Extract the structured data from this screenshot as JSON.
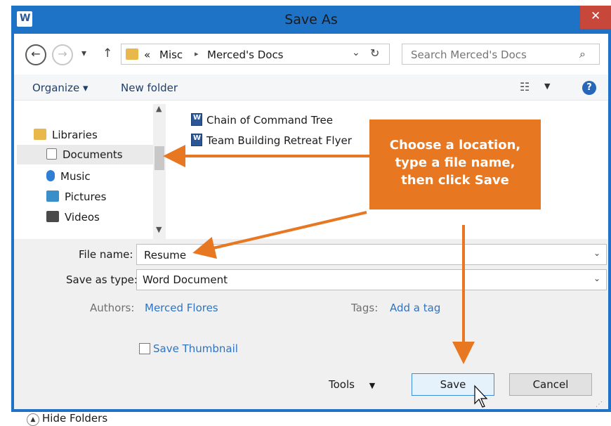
{
  "window": {
    "title": "Save As",
    "app_icon": "W",
    "close_glyph": "✕"
  },
  "navigation": {
    "back_glyph": "←",
    "forward_glyph": "→",
    "recent_glyph": "▾",
    "up_glyph": "↑",
    "breadcrumb_prefix": "«",
    "breadcrumb": [
      "Misc",
      "Merced's Docs"
    ],
    "separator_glyph": "▸",
    "dropdown_glyph": "⌄",
    "refresh_glyph": "↻"
  },
  "search": {
    "placeholder": "Search Merced's Docs",
    "icon_glyph": "⌕"
  },
  "toolbar": {
    "organize": "Organize ▾",
    "new_folder": "New folder",
    "views_glyph": "☷",
    "views_drop": "▼",
    "help_glyph": "?"
  },
  "nav_pane": {
    "items": [
      {
        "label": "Libraries",
        "icon": "libraries-icon",
        "color": "#e8b84a"
      },
      {
        "label": "Documents",
        "icon": "documents-icon",
        "color": "#ffffff",
        "selected": true
      },
      {
        "label": "Music",
        "icon": "music-icon",
        "color": "#2f7fd4"
      },
      {
        "label": "Pictures",
        "icon": "pictures-icon",
        "color": "#3a8fc8"
      },
      {
        "label": "Videos",
        "icon": "videos-icon",
        "color": "#4a4a4a"
      }
    ],
    "scroll_up": "▲",
    "scroll_down": "▼"
  },
  "files": [
    {
      "name": "Chain of Command Tree",
      "icon": "word-doc-icon"
    },
    {
      "name": "Team Building Retreat Flyer",
      "icon": "word-doc-icon"
    }
  ],
  "form": {
    "file_name_label": "File name:",
    "file_name_value": "Resume",
    "save_type_label": "Save as type:",
    "save_type_value": "Word Document",
    "authors_label": "Authors:",
    "authors_value": "Merced Flores",
    "tags_label": "Tags:",
    "tags_value": "Add a tag",
    "thumbnail_label": "Save Thumbnail",
    "chevron_glyph": "⌄"
  },
  "footer": {
    "hide_folders": "Hide Folders",
    "hide_glyph": "▲",
    "tools": "Tools",
    "tools_drop": "▼",
    "save": "Save",
    "cancel": "Cancel",
    "grip_glyph": "⋰"
  },
  "callout": {
    "lines": [
      "Choose a location,",
      "type a file name,",
      "then click Save"
    ],
    "color": "#e87722"
  },
  "colors": {
    "title_bar": "#1e73c6",
    "close": "#c7473b",
    "link": "#2f73c2"
  }
}
